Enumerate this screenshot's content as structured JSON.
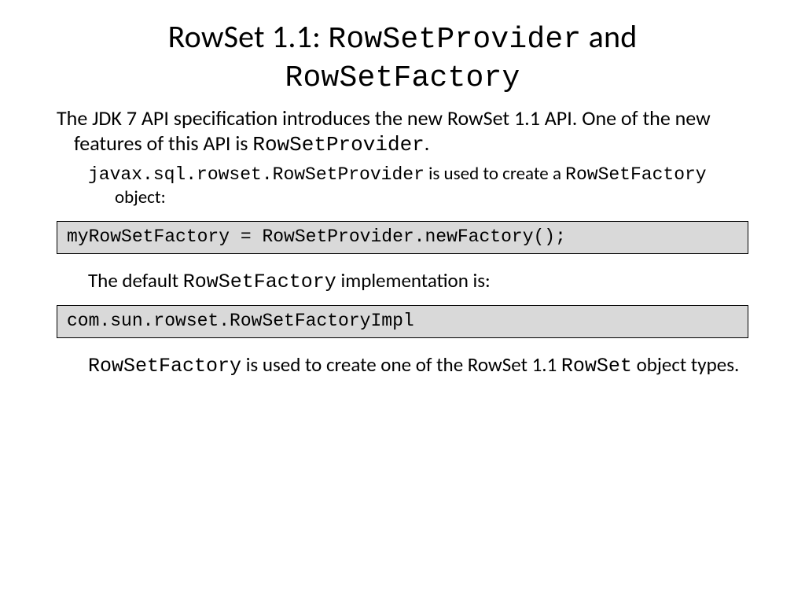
{
  "title": {
    "part1": "RowSet 1.1: ",
    "code1": "RowSetProvider",
    "part2": " and ",
    "code2": "RowSetFactory"
  },
  "intro": {
    "part1": "The JDK 7 API specification introduces the new RowSet 1.1 API. One of the new features of this API is ",
    "code1": "RowSetProvider",
    "part2": "."
  },
  "usage": {
    "code1": "javax.sql.rowset.RowSetProvider",
    "part1": " is used to create a ",
    "code2": "RowSetFactory",
    "part2": " object:"
  },
  "codebox1": "myRowSetFactory = RowSetProvider.newFactory();",
  "defaultImpl": {
    "part1": "The default ",
    "code1": "RowSetFactory",
    "part2": " implementation is:"
  },
  "codebox2": "com.sun.rowset.RowSetFactoryImpl",
  "final": {
    "code1": "RowSetFactory",
    "part1": " is used to create one of the RowSet 1.1 ",
    "code2": "RowSet",
    "part2": " object types."
  }
}
